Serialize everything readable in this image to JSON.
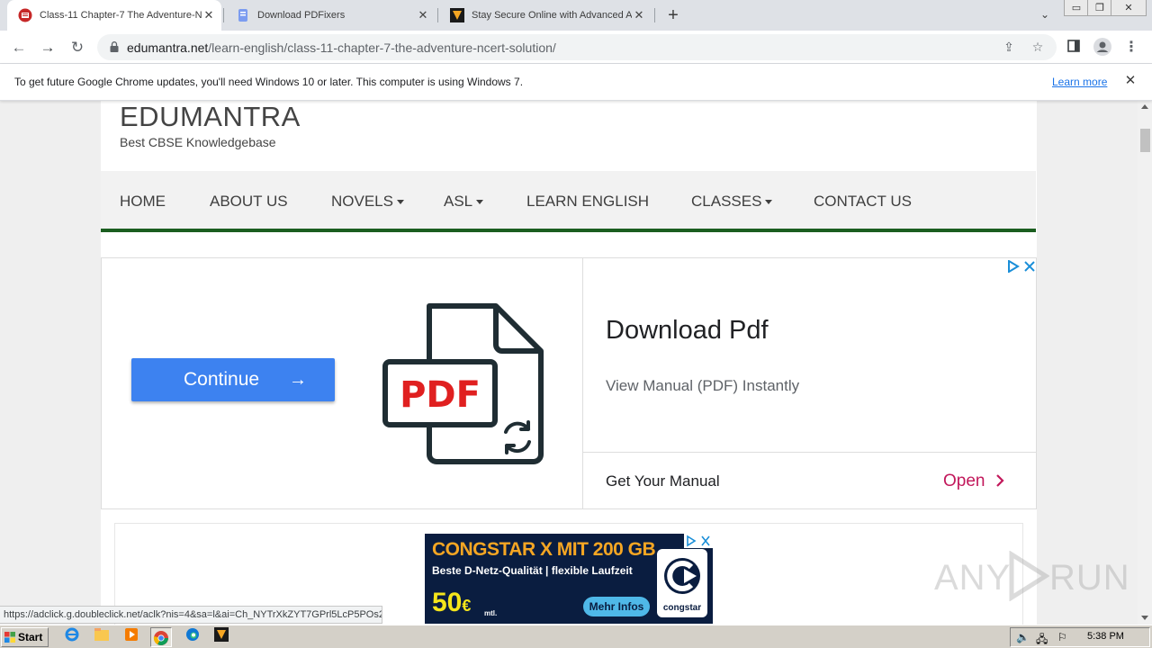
{
  "browser": {
    "tabs": [
      {
        "title": "Class-11 Chapter-7 The Adventure-N",
        "active": true
      },
      {
        "title": "Download PDFixers",
        "active": false
      },
      {
        "title": "Stay Secure Online with Advanced A",
        "active": false
      }
    ],
    "new_tab_symbol": "+",
    "window_controls": [
      "▭",
      "❐",
      "✕"
    ],
    "url_host": "edumantra.net",
    "url_path": "/learn-english/class-11-chapter-7-the-adventure-ncert-solution/"
  },
  "infobar": {
    "message": "To get future Google Chrome updates, you'll need Windows 10 or later. This computer is using Windows 7.",
    "link": "Learn more"
  },
  "site": {
    "title": "EDUMANTRA",
    "tagline": "Best CBSE Knowledgebase",
    "nav": [
      {
        "label": "HOME",
        "dropdown": false
      },
      {
        "label": "ABOUT US",
        "dropdown": false
      },
      {
        "label": "NOVELS",
        "dropdown": true
      },
      {
        "label": "ASL",
        "dropdown": true
      },
      {
        "label": "LEARN ENGLISH",
        "dropdown": false
      },
      {
        "label": "CLASSES",
        "dropdown": true
      },
      {
        "label": "CONTACT US",
        "dropdown": false
      }
    ],
    "nav_accent": "#1b5e20"
  },
  "ad1": {
    "button": "Continue",
    "button_arrow": "→",
    "graphic_label": "PDF",
    "headline": "Download Pdf",
    "subline": "View Manual (PDF) Instantly",
    "cta_text": "Get Your Manual",
    "cta_action": "Open"
  },
  "ad2": {
    "title": "CONGSTAR X MIT 200 GB",
    "subtitle": "Beste D-Netz-Qualität | flexible Laufzeit",
    "price": "50",
    "currency": "€",
    "price_suffix": "mtl.",
    "button": "Mehr Infos",
    "brand": "congstar"
  },
  "status_url": "https://adclick.g.doubleclick.net/aclk?nis=4&sa=l&ai=Ch_NYTrXkZYT7GPrl5LcP5POs2...",
  "watermark": {
    "left": "ANY",
    "right": "RUN"
  },
  "taskbar": {
    "start": "Start",
    "clock": "5:38 PM"
  }
}
